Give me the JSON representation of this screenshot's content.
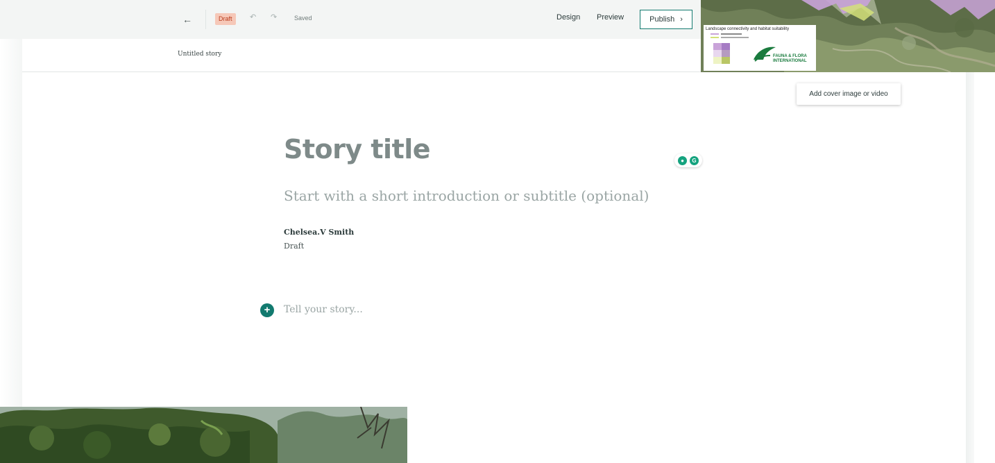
{
  "toolbar": {
    "back_icon": "arrow-left-icon",
    "status_badge": "Draft",
    "undo_icon": "undo-icon",
    "redo_icon": "redo-icon",
    "saved_label": "Saved",
    "design_label": "Design",
    "preview_label": "Preview",
    "publish_label": "Publish",
    "publish_icon": "chevron-right-icon",
    "accent_color": "#127a6f",
    "draft_badge_bg": "#f6c8b8",
    "draft_badge_text": "#b8391a"
  },
  "story_header": {
    "name": "Untitled story"
  },
  "cover": {
    "legend_title": "Landscape connectivity and habitat suitability",
    "legend_org_line1": "FAUNA & FLORA",
    "legend_org_line2": "INTERNATIONAL",
    "add_cover_label": "Add cover image or video"
  },
  "editor": {
    "title_placeholder": "Story title",
    "subtitle_placeholder": "Start with a short introduction or subtitle (optional)",
    "author": "Chelsea.V Smith",
    "author_status": "Draft",
    "body_placeholder": "Tell your story...",
    "add_block_icon": "plus-circle-icon"
  },
  "extensions": {
    "grammarly_icon": "grammarly-icon",
    "location_icon": "location-pin-icon"
  }
}
